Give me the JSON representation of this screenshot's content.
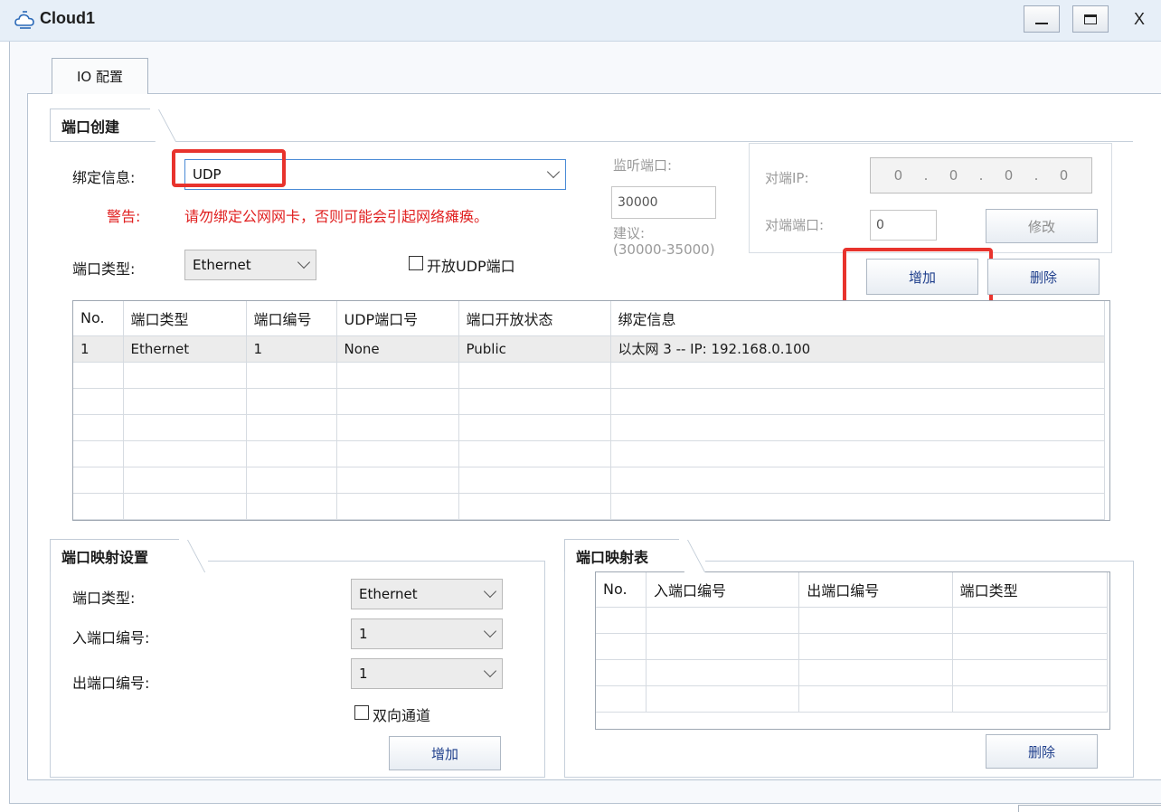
{
  "window": {
    "title": "Cloud1",
    "icon": "cloud-icon",
    "close_label": "X"
  },
  "tabs": [
    {
      "label": "IO 配置"
    }
  ],
  "port_create": {
    "group_title": "端口创建",
    "bind_label": "绑定信息:",
    "bind_value": "UDP",
    "warning_label": "警告:",
    "warning_text": "请勿绑定公网网卡，否则可能会引起网络瘫痪。",
    "port_type_label": "端口类型:",
    "port_type_value": "Ethernet",
    "open_udp_label": "开放UDP端口",
    "open_udp_checked": false,
    "listen_port_label": "监听端口:",
    "listen_port_value": "30000",
    "suggest_label": "建议:",
    "suggest_range": "(30000-35000)",
    "peer_ip_label": "对端IP:",
    "peer_ip_octets": [
      "0",
      "0",
      "0",
      "0"
    ],
    "peer_port_label": "对端端口:",
    "peer_port_value": "0",
    "modify_button": "修改",
    "add_button": "增加",
    "delete_button": "删除"
  },
  "port_table": {
    "columns": [
      "No.",
      "端口类型",
      "端口编号",
      "UDP端口号",
      "端口开放状态",
      "绑定信息"
    ],
    "rows": [
      [
        "1",
        "Ethernet",
        "1",
        "None",
        "Public",
        "以太网 3 -- IP: 192.168.0.100"
      ]
    ]
  },
  "mapping_settings": {
    "group_title": "端口映射设置",
    "port_type_label": "端口类型:",
    "port_type_value": "Ethernet",
    "in_port_label": "入端口编号:",
    "in_port_value": "1",
    "out_port_label": "出端口编号:",
    "out_port_value": "1",
    "bidirectional_label": "双向通道",
    "bidirectional_checked": false,
    "add_button": "增加"
  },
  "mapping_table": {
    "group_title": "端口映射表",
    "columns": [
      "No.",
      "入端口编号",
      "出端口编号",
      "端口类型"
    ],
    "rows": [],
    "delete_button": "删除"
  },
  "colors": {
    "highlight": "#e8332d",
    "warning": "#e02020",
    "accent": "#1f3f8c"
  }
}
